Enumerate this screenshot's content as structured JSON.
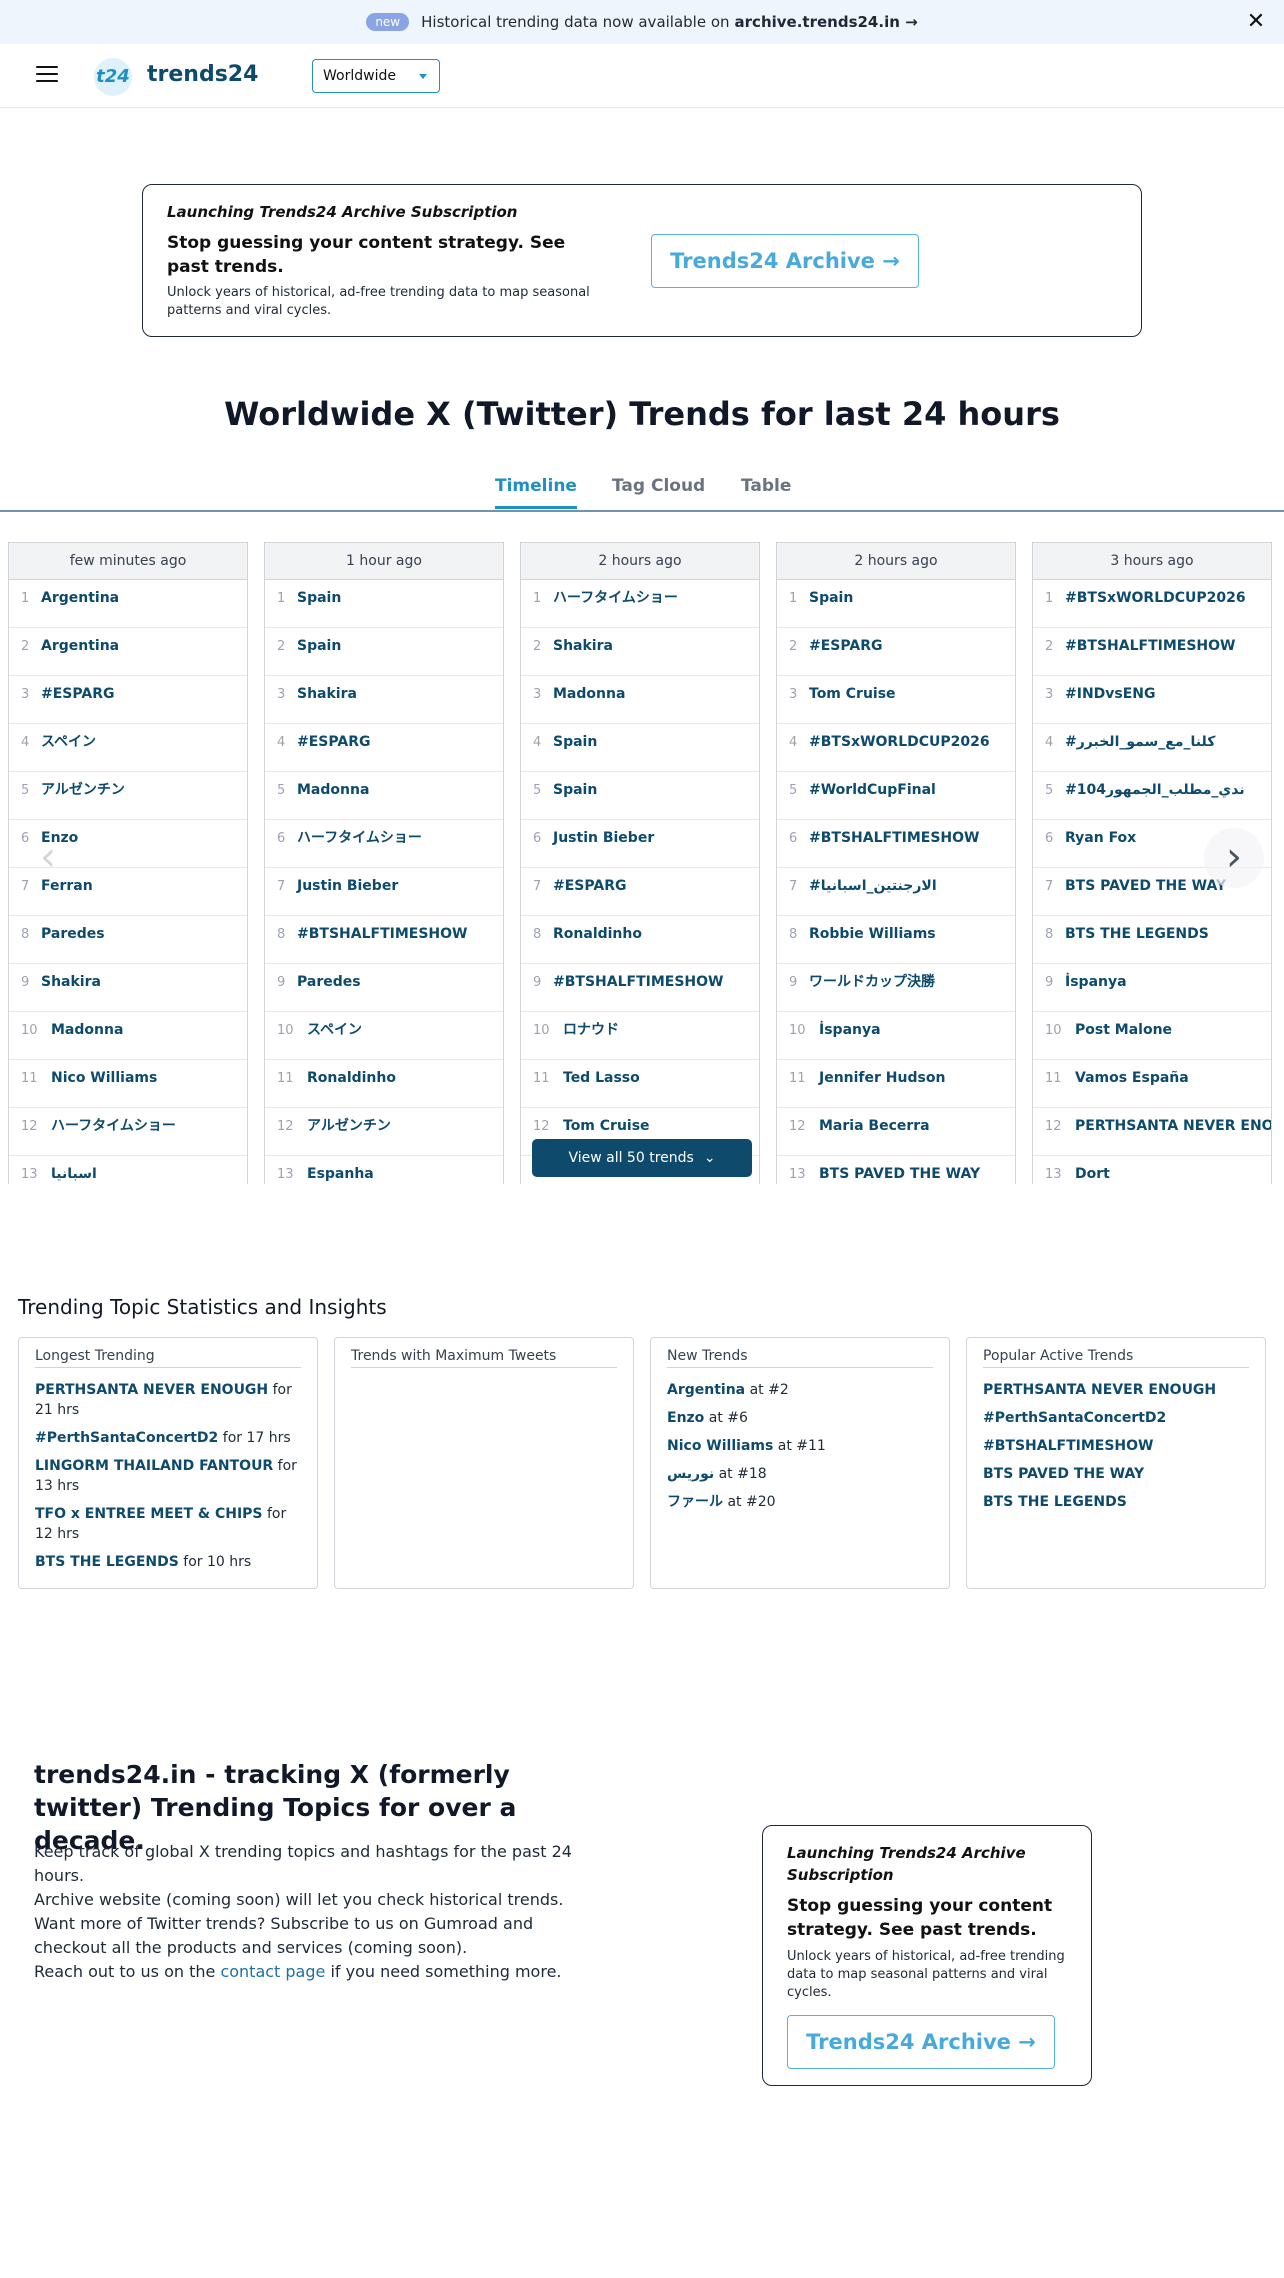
{
  "banner": {
    "badge": "new",
    "text": "Historical trending data now available on",
    "link": "archive.trends24.in →",
    "close_icon": "close-icon"
  },
  "header": {
    "logo_mark": "t24",
    "logo_text": "trends24",
    "region": "Worldwide",
    "menu_icon": "hamburger-icon"
  },
  "promo": {
    "kicker": "Launching Trends24 Archive Subscription",
    "headline": "Stop guessing your content strategy. See past trends.",
    "subtext": "Unlock years of historical, ad-free trending data to map seasonal patterns and viral cycles.",
    "button": "Trends24 Archive →"
  },
  "page_title": "Worldwide X (Twitter) Trends for last 24 hours",
  "tabs": [
    "Timeline",
    "Tag Cloud",
    "Table"
  ],
  "timeline": {
    "view_all": "View all 50 trends",
    "columns": [
      {
        "time": "few minutes ago",
        "trends": [
          "Argentina",
          "Argentina",
          "#ESPARG",
          "スペイン",
          "アルゼンチン",
          "Enzo",
          "Ferran",
          "Paredes",
          "Shakira",
          "Madonna",
          "Nico Williams",
          "ハーフタイムショー",
          "اسبانيا"
        ]
      },
      {
        "time": "1 hour ago",
        "trends": [
          "Spain",
          "Spain",
          "Shakira",
          "#ESPARG",
          "Madonna",
          "ハーフタイムショー",
          "Justin Bieber",
          "#BTSHALFTIMESHOW",
          "Paredes",
          "スペイン",
          "Ronaldinho",
          "アルゼンチン",
          "Espanha"
        ]
      },
      {
        "time": "2 hours ago",
        "trends": [
          "ハーフタイムショー",
          "Shakira",
          "Madonna",
          "Spain",
          "Spain",
          "Justin Bieber",
          "#ESPARG",
          "Ronaldinho",
          "#BTSHALFTIMESHOW",
          "ロナウド",
          "Ted Lasso",
          "Tom Cruise"
        ]
      },
      {
        "time": "2 hours ago",
        "trends": [
          "Spain",
          "#ESPARG",
          "Tom Cruise",
          "#BTSxWORLDCUP2026",
          "#WorldCupFinal",
          "#BTSHALFTIMESHOW",
          "#الارجنتين_اسبانيا",
          "Robbie Williams",
          "ワールドカップ決勝",
          "İspanya",
          "Jennifer Hudson",
          "Maria Becerra",
          "BTS PAVED THE WAY"
        ]
      },
      {
        "time": "3 hours ago",
        "trends": [
          "#BTSxWORLDCUP2026",
          "#BTSHALFTIMESHOW",
          "#INDvsENG",
          "#كلنا_مع_سمو_الخبرر",
          "#104ندي_مطلب_الجمهور",
          "Ryan Fox",
          "BTS PAVED THE WAY",
          "BTS THE LEGENDS",
          "İspanya",
          "Post Malone",
          "Vamos España",
          "PERTHSANTA NEVER ENOUGH",
          "Dort"
        ]
      }
    ]
  },
  "stats": {
    "title": "Trending Topic Statistics and Insights",
    "longest": {
      "title": "Longest Trending",
      "items": [
        {
          "name": "PERTHSANTA NEVER ENOUGH",
          "suffix": "for 21 hrs"
        },
        {
          "name": "#PerthSantaConcertD2",
          "suffix": "for 17 hrs"
        },
        {
          "name": "LINGORM THAILAND FANTOUR",
          "suffix": "for 13 hrs"
        },
        {
          "name": "TFO x ENTREE MEET & CHIPS",
          "suffix": "for 12 hrs"
        },
        {
          "name": "BTS THE LEGENDS",
          "suffix": "for 10 hrs"
        }
      ]
    },
    "max_tweets": {
      "title": "Trends with Maximum Tweets"
    },
    "new_trends": {
      "title": "New Trends",
      "items": [
        {
          "name": "Argentina",
          "suffix": "at #2"
        },
        {
          "name": "Enzo",
          "suffix": "at #6"
        },
        {
          "name": "Nico Williams",
          "suffix": "at #11"
        },
        {
          "name": "نوريس",
          "suffix": "at #18"
        },
        {
          "name": "ファール",
          "suffix": "at #20"
        }
      ]
    },
    "popular": {
      "title": "Popular Active Trends",
      "items": [
        "PERTHSANTA NEVER ENOUGH",
        "#PerthSantaConcertD2",
        "#BTSHALFTIMESHOW",
        "BTS PAVED THE WAY",
        "BTS THE LEGENDS"
      ]
    }
  },
  "about": {
    "title": "trends24.in - tracking X (formerly twitter) Trending Topics for over a decade.",
    "line1": "Keep track of global X trending topics and hashtags for the past 24 hours.",
    "line2": "Archive website (coming soon) will let you check historical trends.",
    "line3": "Want more of Twitter trends? Subscribe to us on Gumroad and checkout all the products and services (coming soon).",
    "line4_pre": "Reach out to us on the",
    "line4_link": "contact page",
    "line4_post": "if you need something more."
  },
  "colors": {
    "brand": "#0d4a6c",
    "accent": "#1f8fc4",
    "banner_bg": "#eef5fc"
  }
}
